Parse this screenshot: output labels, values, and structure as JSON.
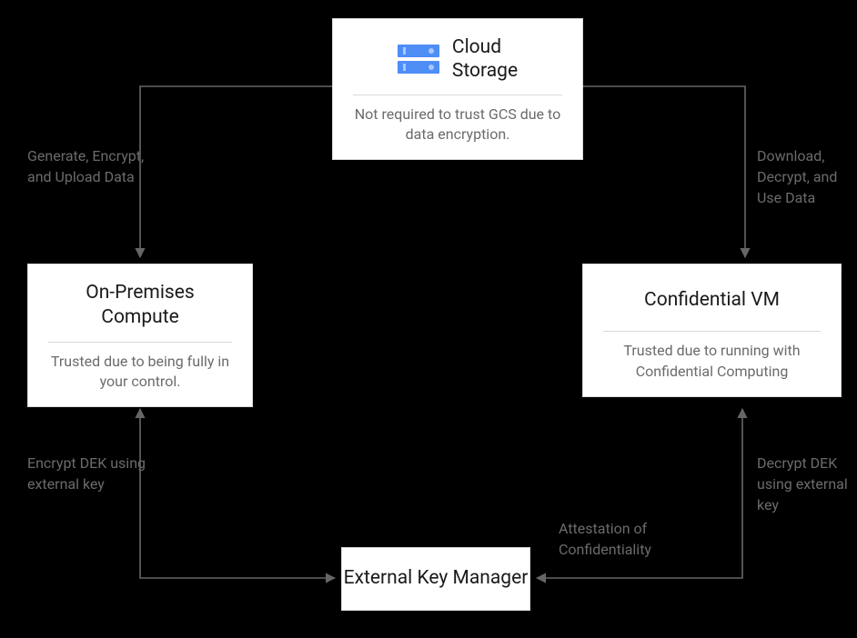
{
  "nodes": {
    "cloud_storage": {
      "title": "Cloud\nStorage",
      "subtitle": "Not required to trust GCS due to data encryption.",
      "icon": "storage-icon"
    },
    "on_prem": {
      "title": "On-Premises Compute",
      "subtitle": "Trusted due to being fully in your control."
    },
    "confidential_vm": {
      "title": "Confidential VM",
      "subtitle": "Trusted due to running with Confidential Computing"
    },
    "ekm": {
      "title": "External Key Manager"
    }
  },
  "edges": {
    "gen_encrypt_upload": "Generate, Encrypt, and Upload Data",
    "download_decrypt_use": "Download, Decrypt, and Use Data",
    "encrypt_dek": "Encrypt DEK using external key",
    "decrypt_dek": "Decrypt DEK using external key",
    "attestation": "Attestation of Confidentiality"
  }
}
